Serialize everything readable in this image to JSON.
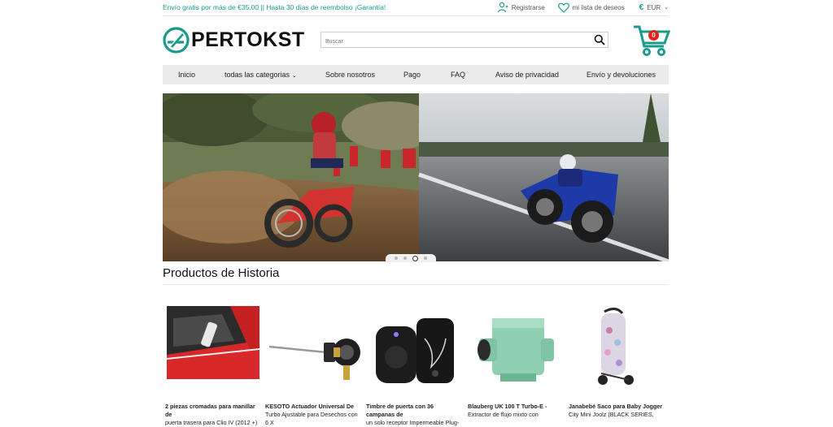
{
  "topbar": {
    "promo": "Envío gratis por más de €35.00  ||  Hasta 30 días de reembolso ¡Garantía!",
    "register": "Registrarse",
    "wishlist": "mi lista de deseos",
    "currency": "EUR"
  },
  "header": {
    "logo_text": "PERTOKST",
    "search_placeholder": "Buscar",
    "cart_count": "0"
  },
  "nav": {
    "items": [
      "Inicio",
      "todas las categorias",
      "Sobre nosotros",
      "Pago",
      "FAQ",
      "Aviso de privacidad",
      "Envío y devoluciones"
    ]
  },
  "slider": {
    "slides": 4,
    "active": 3
  },
  "section": {
    "title": "Productos de Historia"
  },
  "products": [
    {
      "title": "2 piezas cromadas para manillar de",
      "title2": "puerta trasera para Clio IV (2012 +)"
    },
    {
      "title": "KESOTO Actuador Universal De",
      "title2": "Turbo Ajustable para Desechos con 6 X"
    },
    {
      "title": "Timbre de puerta con 36 campanas de",
      "title2": "un solo receptor Impermeable Plug-"
    },
    {
      "title": "Blauberg UK 100 T Turbo-E -",
      "title2": "Extractor de flujo mixto con"
    },
    {
      "title": "Janabebé Saco para Baby Jogger",
      "title2": "City Mini Joolz (BLACK SERIES,"
    }
  ],
  "colors": {
    "accent": "#1a9a8a",
    "nav_bg": "#ebebeb",
    "badge": "#e2231a"
  }
}
